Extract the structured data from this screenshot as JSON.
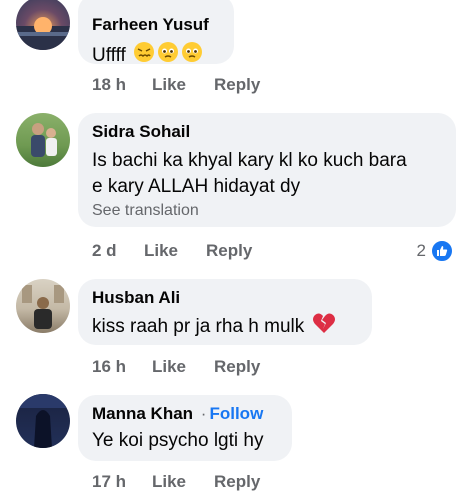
{
  "comments": [
    {
      "author": "Farheen Yusuf",
      "text": "Uffff",
      "emojis": [
        "persevering-face",
        "pleading-face",
        "pleading-face"
      ],
      "time": "18 h",
      "like_label": "Like",
      "reply_label": "Reply"
    },
    {
      "author": "Sidra Sohail",
      "text_line1": "Is bachi ka khyal kary kl ko kuch bara",
      "text_line2": "e kary ALLAH hidayat dy",
      "see_translation": "See translation",
      "time": "2 d",
      "like_label": "Like",
      "reply_label": "Reply",
      "reaction_count": "2",
      "reaction_icon": "thumbs-up-icon"
    },
    {
      "author": "Husban Ali",
      "text": "kiss raah pr ja rha h mulk",
      "emojis": [
        "broken-heart"
      ],
      "time": "16 h",
      "like_label": "Like",
      "reply_label": "Reply"
    },
    {
      "author": "Manna Khan",
      "dot": "·",
      "follow_label": "Follow",
      "text": "Ye koi psycho lgti hy",
      "time": "17 h",
      "like_label": "Like",
      "reply_label": "Reply"
    }
  ],
  "colors": {
    "bubble_bg": "#f0f2f5",
    "meta_gray": "#65676b",
    "link_blue": "#1877f2"
  }
}
